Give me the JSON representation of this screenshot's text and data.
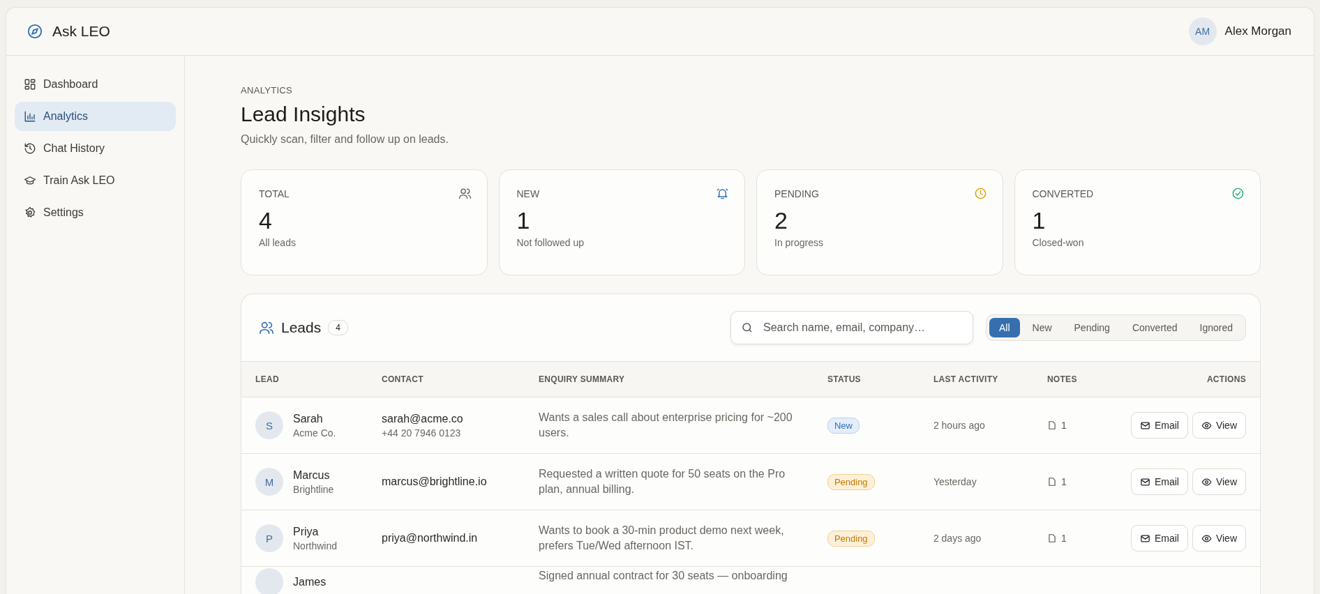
{
  "app": {
    "title": "Ask LEO"
  },
  "user": {
    "initials": "AM",
    "name": "Alex Morgan"
  },
  "sidebar": {
    "items": [
      {
        "label": "Dashboard",
        "kind": "dashboard",
        "selected": false
      },
      {
        "label": "Analytics",
        "kind": "analytics",
        "selected": true
      },
      {
        "label": "Chat History",
        "kind": "history",
        "selected": false
      },
      {
        "label": "Train Ask LEO",
        "kind": "train",
        "selected": false
      },
      {
        "label": "Settings",
        "kind": "settings",
        "selected": false
      }
    ]
  },
  "page": {
    "eyebrow": "ANALYTICS",
    "title": "Lead Insights",
    "subtitle": "Quickly scan, filter and follow up on leads."
  },
  "stats": [
    {
      "label": "TOTAL",
      "value": "4",
      "caption": "All leads",
      "kind": "users",
      "color": "#6b6b6b"
    },
    {
      "label": "NEW",
      "value": "1",
      "caption": "Not followed up",
      "kind": "bell",
      "color": "#2f6fb5"
    },
    {
      "label": "PENDING",
      "value": "2",
      "caption": "In progress",
      "kind": "clock",
      "color": "#e0a100"
    },
    {
      "label": "CONVERTED",
      "value": "1",
      "caption": "Closed-won",
      "kind": "check",
      "color": "#1fae74"
    }
  ],
  "leads": {
    "title": "Leads",
    "count": "4",
    "search": {
      "placeholder": "Search name, email, company…"
    },
    "filters": [
      {
        "label": "All",
        "selected": true
      },
      {
        "label": "New",
        "selected": false
      },
      {
        "label": "Pending",
        "selected": false
      },
      {
        "label": "Converted",
        "selected": false
      },
      {
        "label": "Ignored",
        "selected": false
      }
    ],
    "columns": [
      "LEAD",
      "CONTACT",
      "ENQUIRY SUMMARY",
      "STATUS",
      "LAST ACTIVITY",
      "NOTES",
      "ACTIONS"
    ],
    "rows": [
      {
        "initial": "S",
        "name": "Sarah",
        "company": "Acme Co.",
        "email": "sarah@acme.co",
        "phone": "+44 20 7946 0123",
        "summary": "Wants a sales call about enterprise pricing for ~200 users.",
        "status": {
          "label": "New",
          "kind": "new"
        },
        "last_activity": "2 hours ago",
        "notes": "1",
        "actions": [
          "Email",
          "View"
        ]
      },
      {
        "initial": "M",
        "name": "Marcus",
        "company": "Brightline",
        "email": "marcus@brightline.io",
        "summary": "Requested a written quote for 50 seats on the Pro plan, annual billing.",
        "status": {
          "label": "Pending",
          "kind": "pending"
        },
        "last_activity": "Yesterday",
        "notes": "1",
        "actions": [
          "Email",
          "View"
        ]
      },
      {
        "initial": "P",
        "name": "Priya",
        "company": "Northwind",
        "email": "priya@northwind.in",
        "summary": "Wants to book a 30-min product demo next week, prefers Tue/Wed afternoon IST.",
        "status": {
          "label": "Pending",
          "kind": "pending"
        },
        "last_activity": "2 days ago",
        "notes": "1",
        "actions": [
          "Email",
          "View"
        ]
      },
      {
        "name": "James",
        "summary": "Signed annual contract for 30 seats — onboarding"
      }
    ]
  }
}
